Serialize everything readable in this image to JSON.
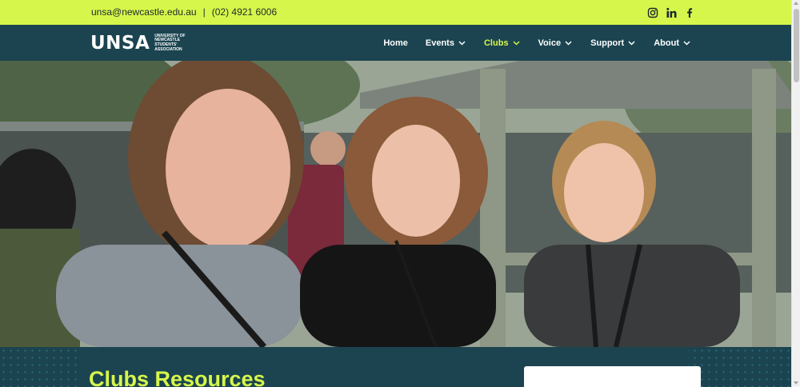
{
  "topbar": {
    "email": "unsa@newcastle.edu.au",
    "separator": "|",
    "phone": "(02) 4921 6006",
    "social": [
      "instagram-icon",
      "linkedin-icon",
      "facebook-icon"
    ]
  },
  "header": {
    "logo_text": "UNSA",
    "logo_subtitle": "University of Newcastle Students' Association"
  },
  "nav": {
    "items": [
      {
        "label": "Home",
        "has_dropdown": false
      },
      {
        "label": "Events",
        "has_dropdown": true
      },
      {
        "label": "Clubs",
        "has_dropdown": true,
        "active": true
      },
      {
        "label": "Voice",
        "has_dropdown": true
      },
      {
        "label": "Support",
        "has_dropdown": true
      },
      {
        "label": "About",
        "has_dropdown": true
      }
    ]
  },
  "main": {
    "title": "Clubs Resources"
  },
  "colors": {
    "accent": "#d7f64b",
    "navbar": "#1b4450",
    "text_dark": "#1b2a2e"
  }
}
